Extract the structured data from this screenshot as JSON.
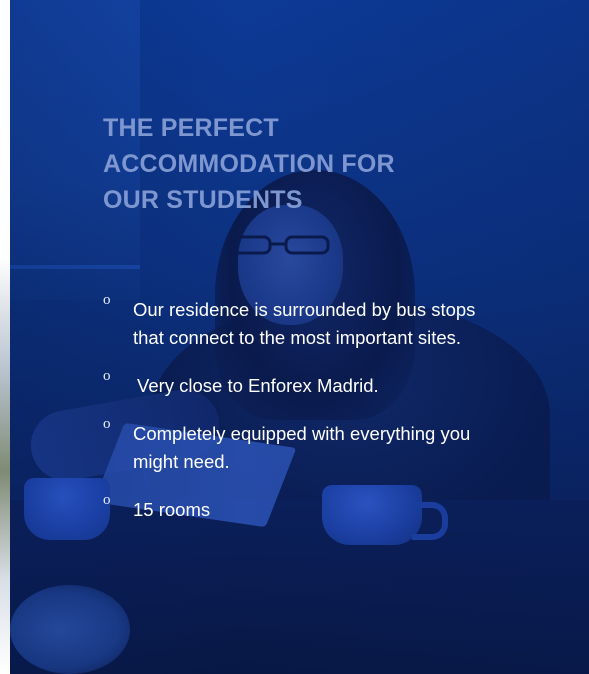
{
  "headline": {
    "line1": "THE PERFECT",
    "line2": "ACCOMMODATION FOR",
    "line3": "OUR STUDENTS"
  },
  "features": [
    {
      "bullet": "o",
      "text": "Our residence is surrounded by bus stops that connect to the most important sites."
    },
    {
      "bullet": "o",
      "text": "Very close to Enforex Madrid."
    },
    {
      "bullet": "o",
      "text": "Completely equipped with everything you might need."
    },
    {
      "bullet": "o",
      "text": "15 rooms"
    }
  ],
  "colors": {
    "overlay": "#0c3180",
    "headline": "#7e97d0",
    "text": "#ffffff"
  }
}
